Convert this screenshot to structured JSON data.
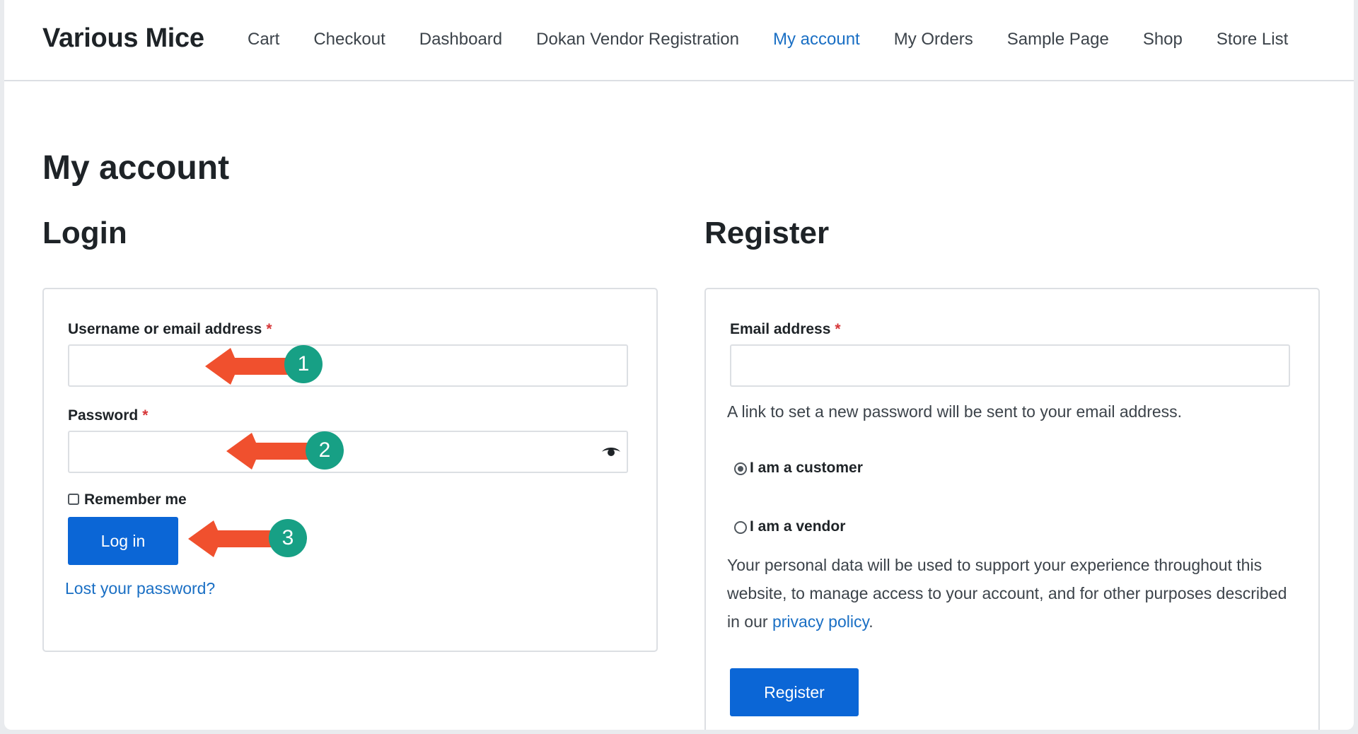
{
  "site": {
    "title": "Various Mice"
  },
  "nav": {
    "items": [
      {
        "label": "Cart"
      },
      {
        "label": "Checkout"
      },
      {
        "label": "Dashboard"
      },
      {
        "label": "Dokan Vendor Registration"
      },
      {
        "label": "My account",
        "active": true
      },
      {
        "label": "My Orders"
      },
      {
        "label": "Sample Page"
      },
      {
        "label": "Shop"
      },
      {
        "label": "Store List"
      }
    ]
  },
  "page": {
    "title": "My account"
  },
  "login": {
    "heading": "Login",
    "username_label": "Username or email address",
    "required_mark": "*",
    "username_value": "",
    "password_label": "Password",
    "password_value": "",
    "remember_label": "Remember me",
    "login_button": "Log in",
    "lost_password": "Lost your password?"
  },
  "register": {
    "heading": "Register",
    "email_label": "Email address",
    "email_value": "",
    "password_note": "A link to set a new password will be sent to your email address.",
    "role_customer": "I am a customer",
    "role_vendor": "I am a vendor",
    "privacy_text_before": "Your personal data will be used to support your experience throughout this website, to manage access to your account, and for other purposes described in our ",
    "privacy_link": "privacy policy",
    "privacy_text_after": ".",
    "register_button": "Register"
  },
  "annotations": {
    "badges": [
      "1",
      "2",
      "3"
    ],
    "arrow_color": "#f0502e",
    "badge_color": "#17a085"
  },
  "colors": {
    "accent": "#0b66d6",
    "link": "#1a6fc4",
    "required": "#d63638"
  }
}
